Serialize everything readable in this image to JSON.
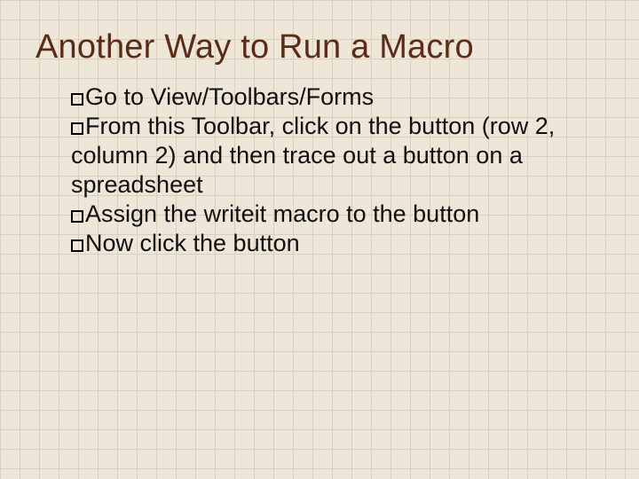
{
  "slide": {
    "title": "Another Way to Run a Macro",
    "bullets": [
      {
        "lead": "Go",
        "rest": " to View/Toolbars/Forms"
      },
      {
        "lead": "From",
        "rest": " this Toolbar, click on the button (row 2, column 2) and then trace out a button on a spreadsheet"
      },
      {
        "lead": "Assign",
        "rest": " the writeit macro to the button"
      },
      {
        "lead": "Now",
        "rest": " click the button"
      }
    ]
  }
}
